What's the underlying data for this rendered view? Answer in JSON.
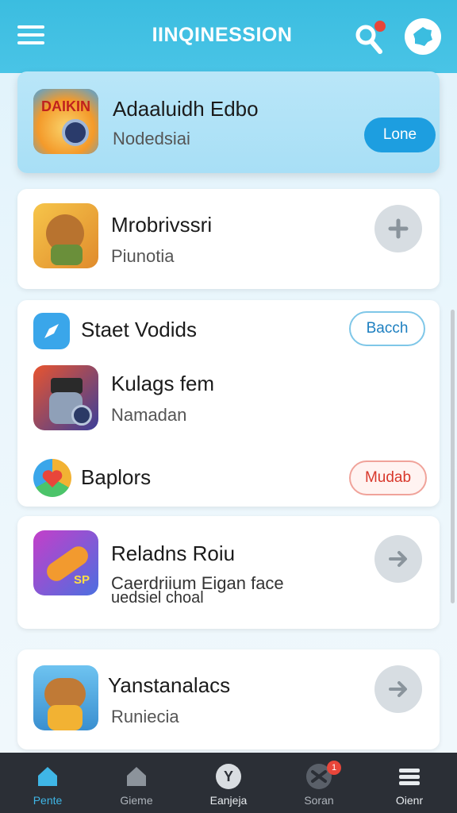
{
  "header": {
    "title": "IINQINESSION",
    "menu_icon": "hamburger-menu-icon",
    "search_icon": "search-icon",
    "profile_icon": "profile-icon"
  },
  "featured": {
    "icon_text": "DAIKIN",
    "title": "Adaaluidh Edbo",
    "subtitle": "Nodedsiai",
    "button_label": "Lone"
  },
  "card1": {
    "title": "Mrobrivssri",
    "subtitle": "Piunotia",
    "action_icon": "plus-icon"
  },
  "section": {
    "title": "Staet Vodids",
    "button_label": "Bacch",
    "icon": "compass-icon"
  },
  "section_item": {
    "title": "Kulags fem",
    "subtitle": "Namadan"
  },
  "section_footer": {
    "title": "Baplors",
    "button_label": "Mudab",
    "icon": "heart-icon"
  },
  "card2": {
    "title": "Reladns Roiu",
    "subtitle": "Caerdriium Eigan face",
    "subtitle2": "uedsiel choal",
    "icon_text": "SP",
    "action_icon": "arrow-right-icon"
  },
  "card3": {
    "title": "Yanstanalacs",
    "subtitle": "Runiecia",
    "action_icon": "arrow-right-icon"
  },
  "nav": [
    {
      "label": "Pente",
      "icon": "home-icon"
    },
    {
      "label": "Gieme",
      "icon": "home-icon"
    },
    {
      "label": "Eanjeja",
      "icon": "y-badge-icon"
    },
    {
      "label": "Soran",
      "icon": "swap-icon",
      "badge": "1"
    },
    {
      "label": "Oienr",
      "icon": "menu-icon"
    }
  ],
  "colors": {
    "accent": "#3bbde0",
    "primary_button": "#1d9ee0",
    "danger": "#e8463a",
    "nav_bg": "#2b2f36"
  }
}
